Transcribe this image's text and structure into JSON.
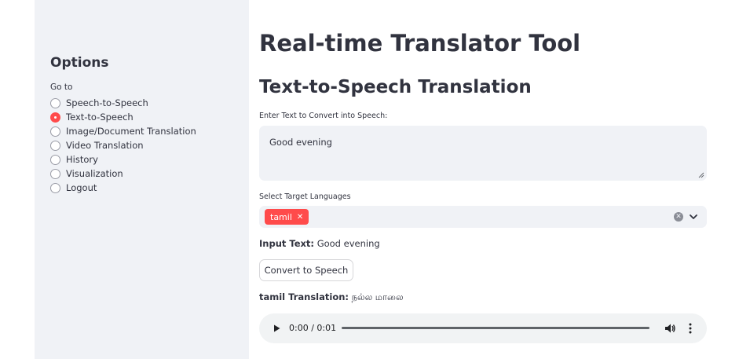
{
  "sidebar": {
    "title": "Options",
    "radio_label": "Go to",
    "items": [
      {
        "label": "Speech-to-Speech",
        "selected": false
      },
      {
        "label": "Text-to-Speech",
        "selected": true
      },
      {
        "label": "Image/Document Translation",
        "selected": false
      },
      {
        "label": "Video Translation",
        "selected": false
      },
      {
        "label": "History",
        "selected": false
      },
      {
        "label": "Visualization",
        "selected": false
      },
      {
        "label": "Logout",
        "selected": false
      }
    ]
  },
  "main": {
    "app_title": "Real-time Translator Tool",
    "section_title": "Text-to-Speech Translation",
    "text_input_label": "Enter Text to Convert into Speech:",
    "text_input_value": "Good evening",
    "languages_label": "Select Target Languages",
    "selected_languages": [
      "tamil"
    ],
    "input_text_label": "Input Text:",
    "input_text_value": "Good evening",
    "convert_button_label": "Convert to Speech",
    "translation_label": "tamil Translation:",
    "translation_value": "நல்ல மாலை",
    "audio": {
      "time": "0:00 / 0:01"
    }
  },
  "colors": {
    "accent": "#ff4b4b",
    "sidebar_bg": "#f0f2f6",
    "text": "#31333f"
  },
  "icons": [
    "radio-icon",
    "close-icon",
    "clear-icon",
    "chevron-down-icon",
    "play-icon",
    "volume-icon",
    "more-vertical-icon",
    "resize-handle-icon"
  ]
}
